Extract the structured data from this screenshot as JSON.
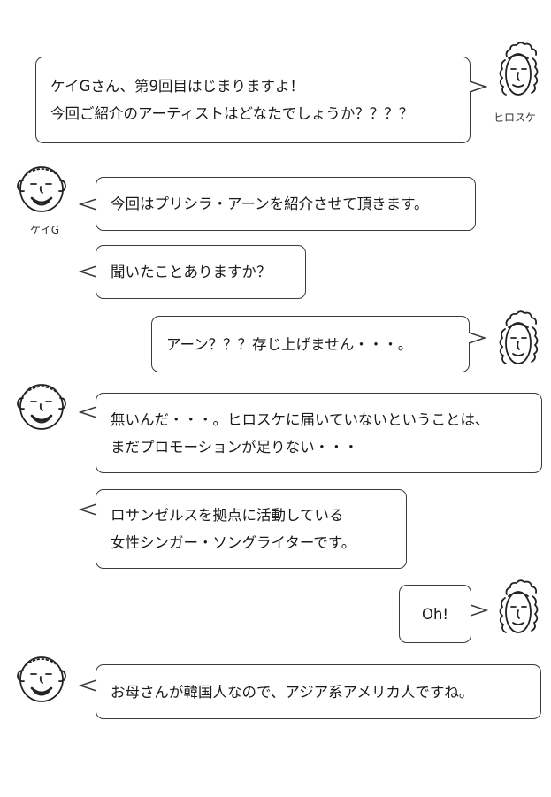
{
  "speakers": {
    "hirosuke": {
      "name": "ヒロスケ",
      "icon": "curly-hair-man-face-icon"
    },
    "keig": {
      "name": "ケイG",
      "icon": "bald-bearded-man-face-icon"
    }
  },
  "messages": [
    {
      "speaker": "hirosuke",
      "lines": [
        "ケイGさん、第9回目はじまりますよ！",
        "今回ご紹介のアーティストはどなたでしょうか？？？？"
      ]
    },
    {
      "speaker": "keig",
      "lines": [
        "今回はプリシラ・アーンを紹介させて頂きます。"
      ]
    },
    {
      "speaker": "keig",
      "lines": [
        "聞いたことありますか？"
      ]
    },
    {
      "speaker": "hirosuke",
      "lines": [
        "アーン？？？存じ上げません・・・。"
      ]
    },
    {
      "speaker": "keig",
      "lines": [
        "無いんだ・・・。ヒロスケに届いていないということは、",
        "まだプロモーションが足りない・・・"
      ]
    },
    {
      "speaker": "keig",
      "lines": [
        "ロサンゼルスを拠点に活動している",
        "女性シンガー・ソングライターです。"
      ]
    },
    {
      "speaker": "hirosuke",
      "lines": [
        "Oh!"
      ]
    },
    {
      "speaker": "keig",
      "lines": [
        "お母さんが韓国人なので、アジア系アメリカ人ですね。"
      ]
    }
  ]
}
